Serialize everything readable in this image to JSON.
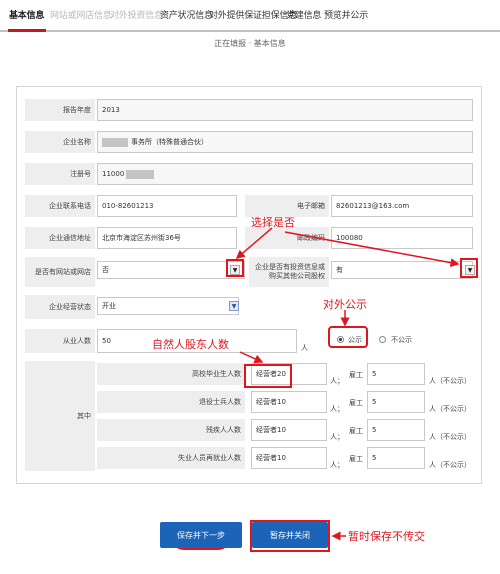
{
  "tabs": [
    {
      "label": "基本信息",
      "state": "active"
    },
    {
      "label": "网站或网店信息",
      "state": "inactive"
    },
    {
      "label": "对外投资信息",
      "state": "inactive"
    },
    {
      "label": "资产状况信息",
      "state": "normal"
    },
    {
      "label": "对外提供保证担保信息",
      "state": "normal"
    },
    {
      "label": "党建信息",
      "state": "normal"
    },
    {
      "label": "预览并公示",
      "state": "normal"
    }
  ],
  "subheader": "正在填报 · 基本信息",
  "form": {
    "report_year": {
      "label": "报告年度",
      "value": "2013"
    },
    "company_name": {
      "label": "企业名称",
      "value_suffix": "事务所（特殊普通合伙）"
    },
    "reg_no": {
      "label": "注册号",
      "value": "11000"
    },
    "phone": {
      "label": "企业联系电话",
      "value": "010-82601213"
    },
    "email": {
      "label": "电子邮箱",
      "value": "82601213@163.com"
    },
    "address": {
      "label": "企业通信地址",
      "value": "北京市海淀区苏州街36号"
    },
    "postcode": {
      "label": "邮政编码",
      "value": "100080"
    },
    "has_website": {
      "label": "是否有网站或网店",
      "value": "否"
    },
    "has_investment": {
      "label": "企业是否有投资信息或购买其他公司股权",
      "value": "有"
    },
    "status": {
      "label": "企业经营状态",
      "value": "开业"
    },
    "employees": {
      "label": "从业人数",
      "value": "50",
      "unit": "人"
    },
    "publicity": {
      "public": "公示",
      "private": "不公示"
    },
    "of_which": "其中",
    "rows": [
      {
        "label": "高校毕业生人数",
        "manager_label": "经营者",
        "manager_value": "20",
        "employee_label": "雇工",
        "employee_value": "5",
        "unit": "人；",
        "tail": "人（不公示）"
      },
      {
        "label": "退役士兵人数",
        "manager_label": "经营者",
        "manager_value": "10",
        "employee_label": "雇工",
        "employee_value": "5",
        "unit": "人；",
        "tail": "人（不公示）"
      },
      {
        "label": "残疾人人数",
        "manager_label": "经营者",
        "manager_value": "10",
        "employee_label": "雇工",
        "employee_value": "5",
        "unit": "人；",
        "tail": "人（不公示）"
      },
      {
        "label": "失业人员再就业人数",
        "manager_label": "经营者",
        "manager_value": "10",
        "employee_label": "雇工",
        "employee_value": "5",
        "unit": "人；",
        "tail": "人（不公示）"
      }
    ]
  },
  "annotations": {
    "select_yes_no": "选择是否",
    "external_publicity": "对外公示",
    "natural_person_count": "自然人股东人数",
    "temp_save_no_submit": "暂时保存不传交"
  },
  "buttons": {
    "save_next": "保存并下一步",
    "save_close": "暂存并关闭"
  },
  "colors": {
    "accent": "#c8161d",
    "annotation_red": "#e0161e",
    "button_blue": "#1b64b8"
  }
}
